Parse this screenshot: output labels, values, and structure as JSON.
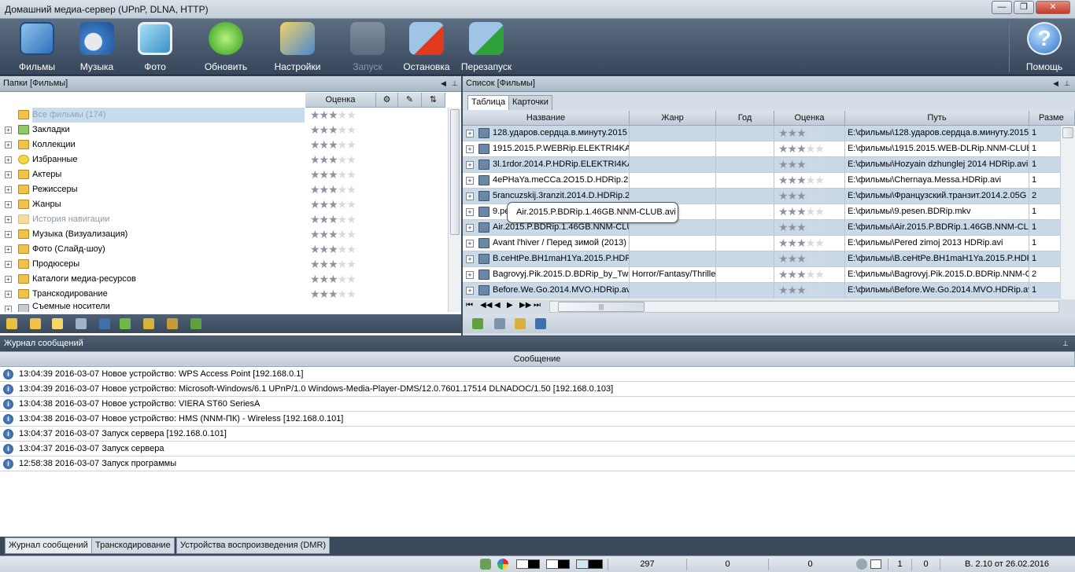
{
  "window": {
    "title": "Домашний медиа-сервер (UPnP, DLNA, HTTP)",
    "minimize": "—",
    "maximize": "❐",
    "close": "✕"
  },
  "toolbar": {
    "buttons": [
      {
        "label": "Фильмы",
        "icon": "films-icon",
        "enabled": true
      },
      {
        "label": "Музыка",
        "icon": "music-icon",
        "enabled": true
      },
      {
        "label": "Фото",
        "icon": "photo-icon",
        "enabled": true
      },
      {
        "label": "Обновить",
        "icon": "refresh-icon",
        "enabled": true
      },
      {
        "label": "Настройки",
        "icon": "settings-icon",
        "enabled": true
      },
      {
        "label": "Запуск",
        "icon": "start-icon",
        "enabled": false
      },
      {
        "label": "Остановка",
        "icon": "stop-icon",
        "enabled": true
      },
      {
        "label": "Перезапуск",
        "icon": "restart-icon",
        "enabled": true
      }
    ],
    "help_label": "Помощь"
  },
  "folders_pane": {
    "title": "Папки [Фильмы]",
    "rating_header": "Оценка",
    "items": [
      {
        "label": "Все фильмы (174)",
        "dim": true,
        "expandable": false,
        "selected": true
      },
      {
        "label": "Закладки",
        "dim": false,
        "expandable": true
      },
      {
        "label": "Коллекции",
        "dim": false,
        "expandable": true
      },
      {
        "label": "Избранные",
        "dim": false,
        "expandable": true
      },
      {
        "label": "Актеры",
        "dim": false,
        "expandable": true
      },
      {
        "label": "Режиссеры",
        "dim": false,
        "expandable": true
      },
      {
        "label": "Жанры",
        "dim": false,
        "expandable": true
      },
      {
        "label": "История навигации",
        "dim": true,
        "expandable": true
      },
      {
        "label": "Музыка (Визуализация)",
        "dim": false,
        "expandable": true
      },
      {
        "label": "Фото (Слайд-шоу)",
        "dim": false,
        "expandable": true
      },
      {
        "label": "Продюсеры",
        "dim": false,
        "expandable": true
      },
      {
        "label": "Каталоги медиа-ресурсов",
        "dim": false,
        "expandable": true
      },
      {
        "label": "Транскодирование",
        "dim": false,
        "expandable": true
      },
      {
        "label": "Съемные носители",
        "dim": false,
        "expandable": true
      }
    ]
  },
  "list_pane": {
    "title": "Список [Фильмы]",
    "tabs": [
      "Таблица",
      "Карточки"
    ],
    "columns": [
      "Название",
      "Жанр",
      "Год",
      "Оценка",
      "Путь",
      "Разме"
    ],
    "rows": [
      {
        "name": "128.ударов.сердца.в.минуту.2015",
        "genre": "",
        "year": "",
        "rating": 3,
        "path": "E:\\фильмы\\128.ударов.сердца.в.минуту.2015",
        "size": "1"
      },
      {
        "name": "1915.2015.P.WEBRip.ELEKTRI4KA.",
        "genre": "",
        "year": "",
        "rating": 3,
        "path": "E:\\фильмы\\1915.2015.WEB-DLRip.NNM-CLUB.a",
        "size": "1"
      },
      {
        "name": "3l.1rdor.2014.P.HDRip.ELEKTRI4KA",
        "genre": "",
        "year": "",
        "rating": 3,
        "path": "E:\\фильмы\\Hozyain dzhunglej 2014 HDRip.avi",
        "size": "1"
      },
      {
        "name": "4ePHaYa.meCCa.2O15.D.HDRip.21",
        "genre": "",
        "year": "",
        "rating": 3,
        "path": "E:\\фильмы\\Chernaya.Messa.HDRip.avi",
        "size": "1"
      },
      {
        "name": "5rancuzskij.3ranzit.2014.D.HDRip.2",
        "genre": "",
        "year": "",
        "rating": 3,
        "path": "E:\\фильмы\\Французский.транзит.2014.2.05G",
        "size": "2"
      },
      {
        "name": "9.pesen.BDRip.mkv",
        "genre": "",
        "year": "",
        "rating": 3,
        "path": "E:\\фильмы\\9.pesen.BDRip.mkv",
        "size": "1"
      },
      {
        "name": "Air.2015.P.BDRip.1.46GB.NNM-CLU",
        "genre": "",
        "year": "",
        "rating": 3,
        "path": "E:\\фильмы\\Air.2015.P.BDRip.1.46GB.NNM-CLU",
        "size": "1"
      },
      {
        "name": "Avant l'hiver / Перед зимой (2013)",
        "genre": "",
        "year": "",
        "rating": 3,
        "path": "E:\\фильмы\\Pered zimoj 2013 HDRip.avi",
        "size": "1"
      },
      {
        "name": "B.ceHtPe.BH1maH1Ya.2015.P.HDR",
        "genre": "",
        "year": "",
        "rating": 3,
        "path": "E:\\фильмы\\B.ceHtPe.BH1maH1Ya.2015.P.HDRi",
        "size": "1"
      },
      {
        "name": "Bagrovyj.Pik.2015.D.BDRip_by_Tw",
        "genre": "Horror/Fantasy/Thrille",
        "year": "",
        "rating": 3,
        "path": "E:\\фильмы\\Bagrovyj.Pik.2015.D.BDRip.NNM-CL",
        "size": "2"
      },
      {
        "name": "Before.We.Go.2014.MVO.HDRip.avi",
        "genre": "",
        "year": "",
        "rating": 3,
        "path": "E:\\фильмы\\Before.We.Go.2014.MVO.HDRip.avi",
        "size": "1"
      }
    ],
    "tooltip": "Air.2015.P.BDRip.1.46GB.NNM-CLUB.avi"
  },
  "log_pane": {
    "title": "Журнал сообщений",
    "column": "Сообщение",
    "messages": [
      "13:04:39 2016-03-07 Новое устройство: WPS Access Point [192.168.0.1]",
      "13:04:39 2016-03-07 Новое устройство: Microsoft-Windows/6.1 UPnP/1.0 Windows-Media-Player-DMS/12.0.7601.17514 DLNADOC/1.50 [192.168.0.103]",
      "13:04:38 2016-03-07 Новое устройство: VIERA ST60 SeriesA",
      "13:04:38 2016-03-07 Новое устройство: HMS (NNM-ПК) - Wireless [192.168.0.101]",
      "13:04:37 2016-03-07 Запуск сервера [192.168.0.101]",
      "13:04:37 2016-03-07 Запуск сервера",
      "12:58:38 2016-03-07 Запуск программы"
    ]
  },
  "bottom_tabs": [
    "Журнал сообщений",
    "Транскодирование",
    "Устройства воспроизведения (DMR)"
  ],
  "statusbar": {
    "count1": "297",
    "count2": "0",
    "count3": "0",
    "count4": "1",
    "count5": "0",
    "version": "В. 2.10 от 26.02.2016"
  },
  "colors": {
    "accent_row": "#c9d9e8",
    "toolbar_bg": "#37465a"
  }
}
